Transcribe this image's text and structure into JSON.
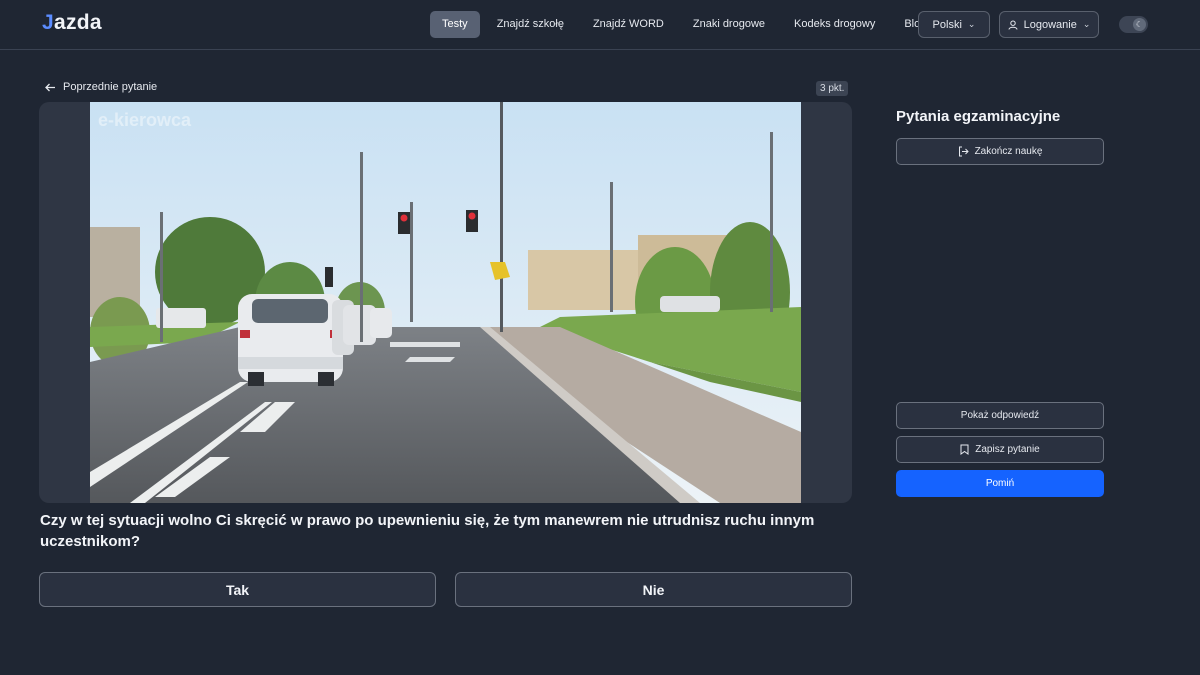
{
  "header": {
    "logo_j": "J",
    "logo_rest": "azda",
    "nav": [
      "Testy",
      "Znajdź szkołę",
      "Znajdź WORD",
      "Znaki drogowe",
      "Kodeks drogowy",
      "Blog"
    ],
    "language": "Polski",
    "login": "Logowanie"
  },
  "question": {
    "back_label": "Poprzednie pytanie",
    "points": "3 pkt.",
    "image_watermark_left": "e-kierowca",
    "text": "Czy w tej sytuacji wolno Ci skręcić w prawo po upewnieniu się, że tym manewrem nie utrudnisz ruchu innym uczestnikom?",
    "answers": [
      "Tak",
      "Nie"
    ]
  },
  "sidebar": {
    "title": "Pytania egzaminacyjne",
    "end_button": "Zakończ naukę",
    "show_answer": "Pokaż odpowiedź",
    "save_question": "Zapisz pytanie",
    "skip": "Pomiń"
  },
  "colors": {
    "background": "#1f2633",
    "primary": "#1563ff",
    "logo_accent": "#5b8cff"
  }
}
